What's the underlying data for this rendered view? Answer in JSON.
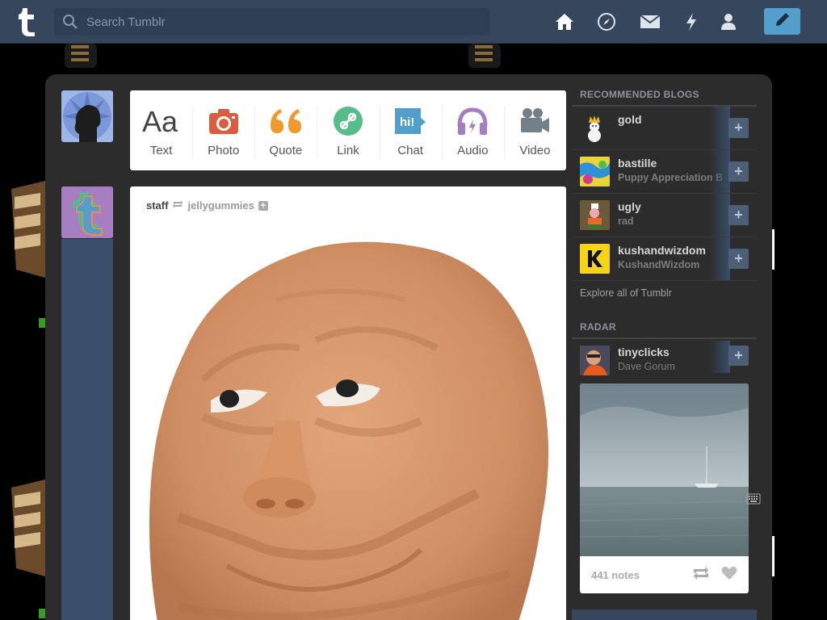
{
  "search": {
    "placeholder": "Search Tumblr"
  },
  "nav": {
    "home": "home-icon",
    "explore": "compass-icon",
    "inbox": "envelope-icon",
    "activity": "lightning-icon",
    "account": "person-icon",
    "compose": "pencil-icon"
  },
  "post_types": [
    {
      "label": "Text",
      "icon": "text-icon",
      "color": "#444444"
    },
    {
      "label": "Photo",
      "icon": "camera-icon",
      "color": "#d95e40"
    },
    {
      "label": "Quote",
      "icon": "quote-icon",
      "color": "#f2992e"
    },
    {
      "label": "Link",
      "icon": "link-icon",
      "color": "#56bc8a"
    },
    {
      "label": "Chat",
      "icon": "chat-icon",
      "color": "#529ecc"
    },
    {
      "label": "Audio",
      "icon": "headphones-icon",
      "color": "#a77dc2"
    },
    {
      "label": "Video",
      "icon": "video-camera-icon",
      "color": "#748089"
    }
  ],
  "post": {
    "author": "staff",
    "reblogged_from": "jellygummies"
  },
  "sidebar": {
    "recommended_title": "RECOMMENDED BLOGS",
    "blogs": [
      {
        "name": "gold",
        "subtitle": ""
      },
      {
        "name": "bastille",
        "subtitle": "Puppy Appreciation Blog"
      },
      {
        "name": "ugly",
        "subtitle": "rad"
      },
      {
        "name": "kushandwizdom",
        "subtitle": "KushandWizdom"
      }
    ],
    "explore_link": "Explore all of Tumblr",
    "radar_title": "RADAR",
    "radar": {
      "name": "tinyclicks",
      "subtitle": "Dave Gorum",
      "notes": "441 notes"
    }
  },
  "colors": {
    "topbar": "#36465d",
    "accent": "#529ecc",
    "panel": "#2c2c2c"
  }
}
